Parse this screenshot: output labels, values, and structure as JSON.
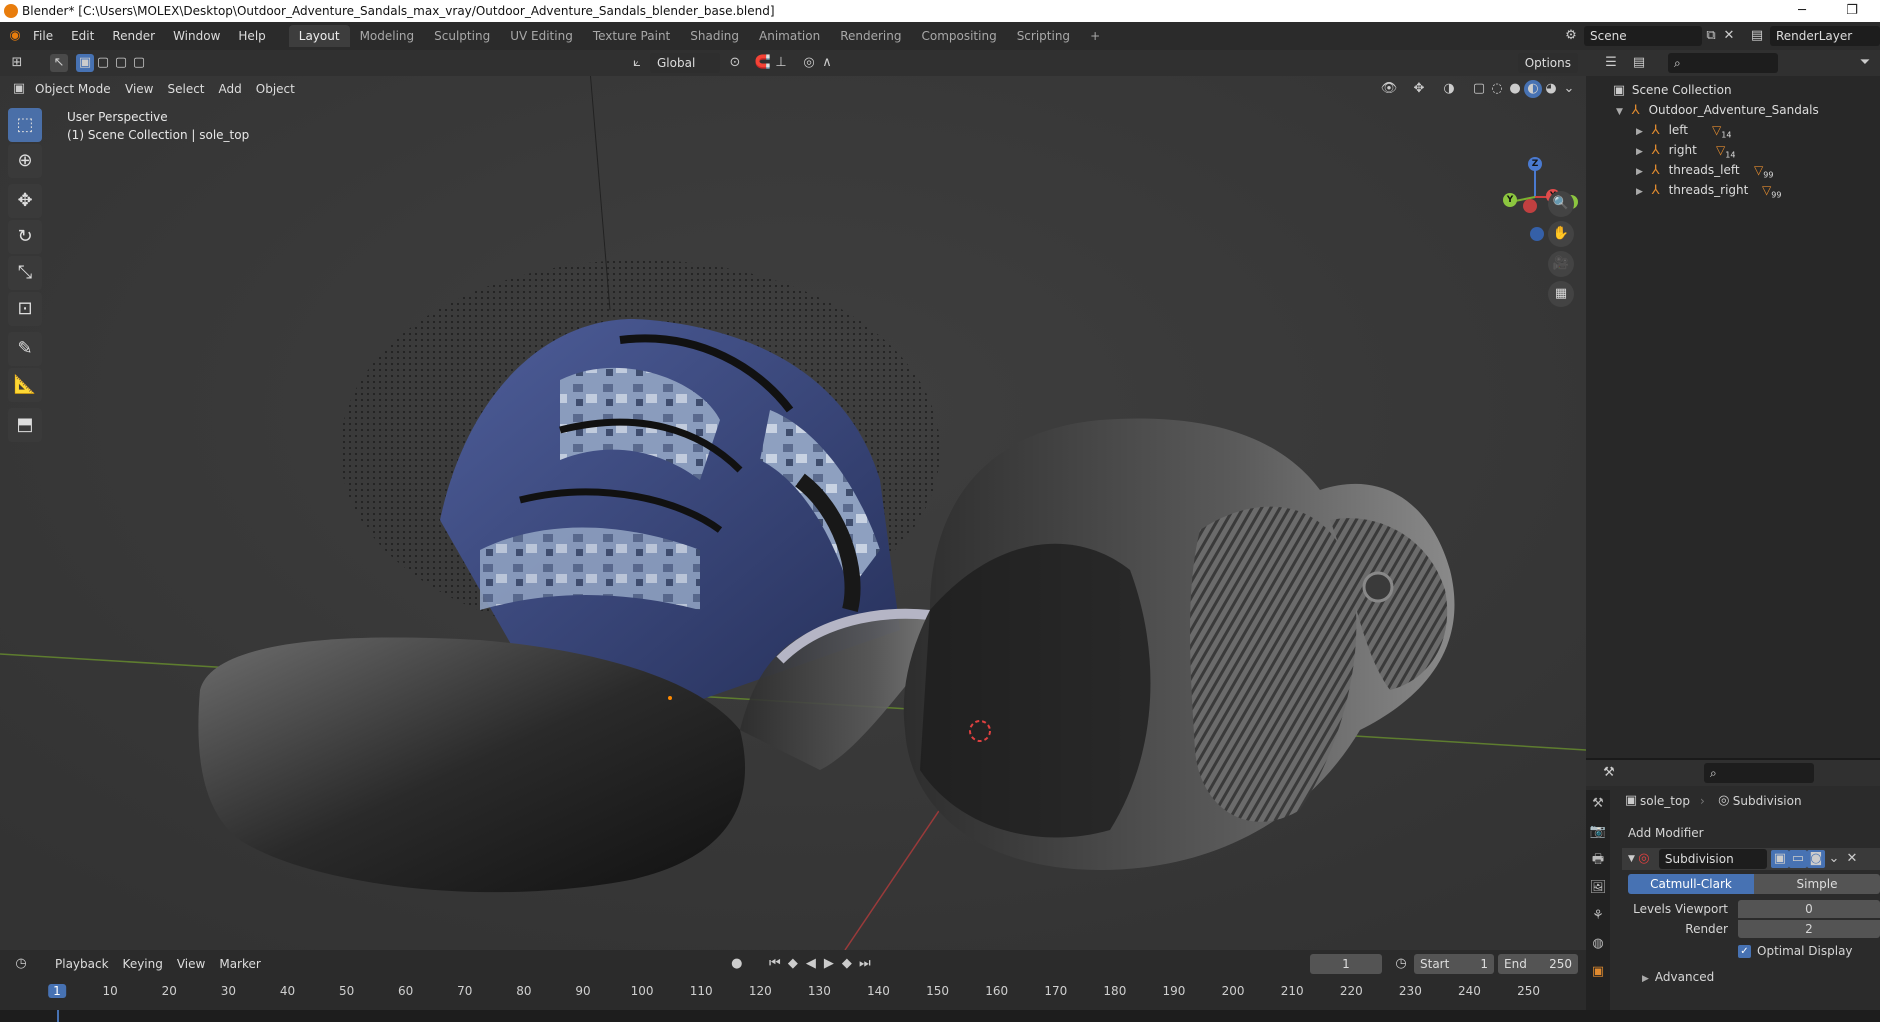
{
  "window": {
    "title": "Blender* [C:\\Users\\MOLEX\\Desktop\\Outdoor_Adventure_Sandals_max_vray/Outdoor_Adventure_Sandals_blender_base.blend]",
    "minimize": "─",
    "restore": "❐"
  },
  "menu": [
    "File",
    "Edit",
    "Render",
    "Window",
    "Help"
  ],
  "workspaces": [
    "Layout",
    "Modeling",
    "Sculpting",
    "UV Editing",
    "Texture Paint",
    "Shading",
    "Animation",
    "Rendering",
    "Compositing",
    "Scripting"
  ],
  "workspace_add": "+",
  "scene": {
    "name": "Scene",
    "view_layer": "RenderLayer"
  },
  "viewport": {
    "transform_orientation": "Global",
    "options_label": "Options",
    "mode": "Object Mode",
    "menus": [
      "View",
      "Select",
      "Add",
      "Object"
    ],
    "overlay_line1": "User Perspective",
    "overlay_line2": "(1) Scene Collection | sole_top",
    "gizmo": {
      "z": "Z",
      "y": "Y",
      "x": "X"
    }
  },
  "outliner": {
    "root": "Scene Collection",
    "collection": "Outdoor_Adventure_Sandals",
    "items": [
      {
        "name": "left",
        "badge": "14"
      },
      {
        "name": "right",
        "badge": "14"
      },
      {
        "name": "threads_left",
        "badge": "99"
      },
      {
        "name": "threads_right",
        "badge": "99"
      }
    ]
  },
  "properties": {
    "object": "sole_top",
    "modifier_crumb": "Subdivision",
    "add_modifier": "Add Modifier",
    "modifier_name": "Subdivision",
    "type_options": [
      "Catmull-Clark",
      "Simple"
    ],
    "type_selected": "Catmull-Clark",
    "levels_viewport_label": "Levels Viewport",
    "levels_viewport": "0",
    "render_label": "Render",
    "render_value": "2",
    "optimal_display_label": "Optimal Display",
    "optimal_display": true,
    "advanced_label": "Advanced"
  },
  "timeline": {
    "menus": [
      "Playback",
      "Keying",
      "View",
      "Marker"
    ],
    "current_frame": "1",
    "start_label": "Start",
    "start": "1",
    "end_label": "End",
    "end": "250",
    "ticks": [
      "1",
      "10",
      "20",
      "30",
      "40",
      "50",
      "60",
      "70",
      "80",
      "90",
      "100",
      "110",
      "120",
      "130",
      "140",
      "150",
      "160",
      "170",
      "180",
      "190",
      "200",
      "210",
      "220",
      "230",
      "240",
      "250"
    ]
  },
  "colors": {
    "accent": "#4772b3",
    "header": "#303030",
    "viewport": "#393939"
  }
}
